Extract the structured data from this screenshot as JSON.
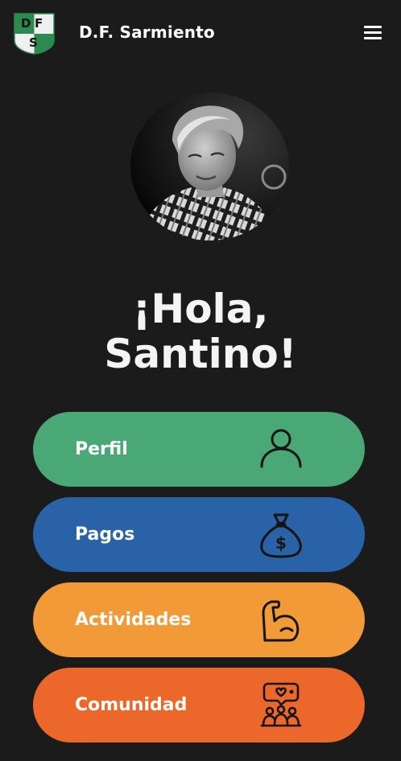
{
  "app": {
    "brand_name": "D.F. Sarmiento",
    "logo_letters": [
      "D",
      "F",
      "S"
    ]
  },
  "greeting": {
    "line1": "¡Hola,",
    "line2": "Santino!"
  },
  "menu": [
    {
      "label": "Perfil",
      "icon": "user-icon",
      "color": "#4aa776"
    },
    {
      "label": "Pagos",
      "icon": "money-bag-icon",
      "color": "#2962a6"
    },
    {
      "label": "Actividades",
      "icon": "muscle-arm-icon",
      "color": "#f29a38"
    },
    {
      "label": "Comunidad",
      "icon": "community-icon",
      "color": "#ec672a"
    }
  ],
  "colors": {
    "background": "#1b1b1b",
    "brand_green": "#2c8a4f"
  }
}
